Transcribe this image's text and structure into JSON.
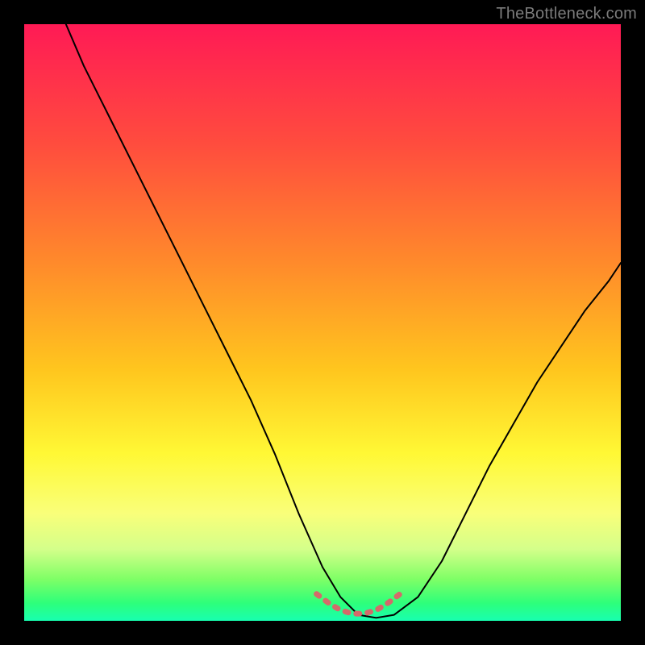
{
  "watermark": {
    "text": "TheBottleneck.com"
  },
  "chart_data": {
    "type": "line",
    "title": "",
    "xlabel": "",
    "ylabel": "",
    "xlim": [
      0,
      100
    ],
    "ylim": [
      0,
      100
    ],
    "grid": false,
    "legend": false,
    "background_gradient": {
      "direction": "top-to-bottom",
      "stops": [
        {
          "pct": 0,
          "color": "#ff1a55"
        },
        {
          "pct": 20,
          "color": "#ff4c3e"
        },
        {
          "pct": 40,
          "color": "#ff8a2b"
        },
        {
          "pct": 58,
          "color": "#ffc61e"
        },
        {
          "pct": 72,
          "color": "#fff835"
        },
        {
          "pct": 82,
          "color": "#f9ff7a"
        },
        {
          "pct": 88,
          "color": "#d4ff8a"
        },
        {
          "pct": 93,
          "color": "#7fff66"
        },
        {
          "pct": 97,
          "color": "#2eff7a"
        },
        {
          "pct": 100,
          "color": "#18ffb0"
        }
      ]
    },
    "series": [
      {
        "name": "bottleneck-curve",
        "color": "#000000",
        "width": 2,
        "x": [
          7,
          10,
          14,
          18,
          22,
          26,
          30,
          34,
          38,
          42,
          46,
          50,
          53,
          56,
          59,
          62,
          66,
          70,
          74,
          78,
          82,
          86,
          90,
          94,
          98,
          100
        ],
        "y": [
          100,
          93,
          85,
          77,
          69,
          61,
          53,
          45,
          37,
          28,
          18,
          9,
          4,
          1,
          0.5,
          1,
          4,
          10,
          18,
          26,
          33,
          40,
          46,
          52,
          57,
          60
        ]
      },
      {
        "name": "zero-band-marker",
        "color": "#d46a6a",
        "width": 7,
        "x": [
          49,
          51,
          53,
          55,
          57,
          59,
          61,
          63
        ],
        "y": [
          4.5,
          3,
          1.8,
          1.2,
          1.2,
          1.8,
          3,
          4.5
        ]
      }
    ]
  }
}
